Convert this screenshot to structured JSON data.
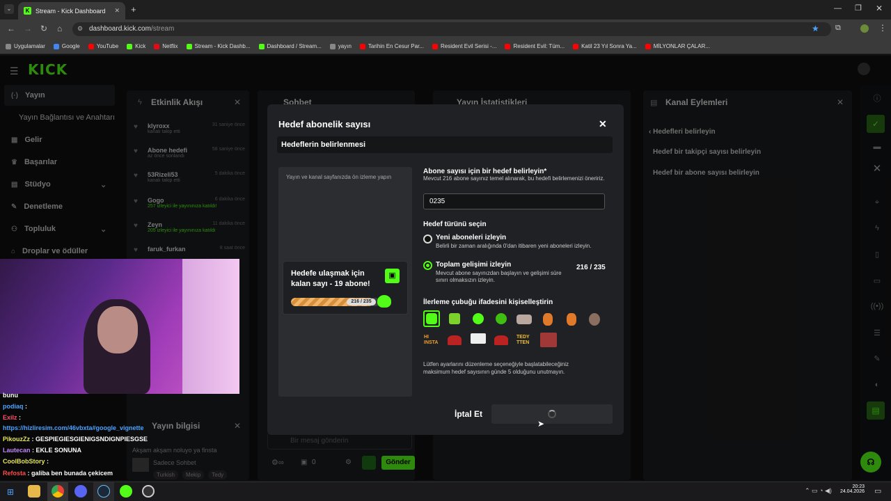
{
  "browser": {
    "tab_title": "Stream - Kick Dashboard",
    "url_host": "dashboard.kick.com",
    "url_path": "/stream",
    "bookmarks": [
      {
        "label": "Uygulamalar",
        "color": "#888"
      },
      {
        "label": "Google",
        "color": "#4285f4"
      },
      {
        "label": "YouTube",
        "color": "#ff0000"
      },
      {
        "label": "Kick",
        "color": "#53fc18"
      },
      {
        "label": "Netflix",
        "color": "#e50914"
      },
      {
        "label": "Stream - Kick Dashb...",
        "color": "#53fc18"
      },
      {
        "label": "Dashboard / Stream...",
        "color": "#53fc18"
      },
      {
        "label": "yayın",
        "color": "#888"
      },
      {
        "label": "Tarihin En Cesur Par...",
        "color": "#ff0000"
      },
      {
        "label": "Resident Evil Serisi -...",
        "color": "#ff0000"
      },
      {
        "label": "Resident Evil: Tüm...",
        "color": "#ff0000"
      },
      {
        "label": "Katil 23 Yıl Sonra Ya...",
        "color": "#ff0000"
      },
      {
        "label": "MİLYONLAR ÇALAR...",
        "color": "#ff0000"
      }
    ]
  },
  "kick": {
    "logo": "KICK",
    "sidebar": [
      "Yayın",
      "Yayın Bağlantısı ve Anahtarı",
      "Gelir",
      "Başarılar",
      "Stüdyo",
      "Denetleme",
      "Topluluk",
      "Droplar ve ödüller"
    ]
  },
  "panels": {
    "activity_title": "Etkinlik Akışı",
    "chat_title": "Sohbet",
    "stats_title": "Yayın İstatistikleri",
    "actions_title": "Kanal Eylemleri",
    "info_title": "Yayın bilgisi",
    "feed": [
      {
        "name": "klyroxx",
        "sub": "kanalı takip etti",
        "time": "31 saniye önce"
      },
      {
        "name": "Abone hedefi",
        "sub": "az önce sonlandı",
        "time": "58 saniye önce"
      },
      {
        "name": "53Rizeli53",
        "sub": "kanalı takip etti",
        "time": "5 dakika önce"
      },
      {
        "name": "Gogo",
        "sub": "257 izleyici ile yayınınıza katıldı!",
        "time": "6 dakika önce"
      },
      {
        "name": "Zeyn",
        "sub": "205 izleyici ile yayınınıza katıldı",
        "time": "11 dakika önce"
      },
      {
        "name": "faruk_furkan",
        "sub": "",
        "time": "8 saat önce"
      }
    ],
    "actions": {
      "back": "Hedefleri belirleyin",
      "item1": "Hedef bir takipçi sayısı belirleyin",
      "item2": "Hedef bir abone sayısı belirleyin"
    },
    "info_subtitle": "Akşam akşam noluyo ya finsta",
    "info_category": "Sadece Sohbet",
    "info_tags": [
      "Turkish",
      "Mekip",
      "Tedy"
    ],
    "chat_placeholder": "Bir mesaj gönderin",
    "chat_count": "0",
    "send_label": "Gönder"
  },
  "modal": {
    "title": "Hedef abonelik sayısı",
    "section": "Hedeflerin belirlenmesi",
    "preview_hint": "Yayın ve kanal sayfanızda ön izleme yapın",
    "widget_text": "Hedefe ulaşmak için kalan sayı - 19 abone!",
    "widget_progress_label": "216 / 235",
    "widget_progress": 0.919,
    "field_label": "Abone sayısı için bir hedef belirleyin*",
    "field_help": "Mevcut 216 abone sayınız temel alınarak, bu hedefi belirlemenizi öneririz.",
    "field_value": "0235",
    "type_label": "Hedef türünü seçin",
    "option1_title": "Yeni aboneleri izleyin",
    "option1_desc": "Belirli bir zaman aralığında 0'dan itibaren yeni aboneleri izleyin.",
    "option2_title": "Toplam gelişimi izleyin",
    "option2_desc": "Mevcut abone sayınızdan başlayın ve gelişimi süre sınırı olmaksızın izleyin.",
    "option2_value": "216 / 235",
    "emote_label": "İlerleme çubuğu ifadesini kişiselleştirin",
    "emote_texts": [
      "HI INSTA",
      "TEDY TTEN"
    ],
    "note": "Lütfen ayarlarını düzenleme seçeneğiyle başlatabileceğiniz maksimum hedef sayısının günde 5 olduğunu unutmayın.",
    "cancel": "İptal Et"
  },
  "chat_messages": [
    {
      "user": "",
      "text": "bunu",
      "color": "#ffffff"
    },
    {
      "user": "podiaq",
      "text": " : ",
      "color": "#4aa3ff"
    },
    {
      "user": "Exilz",
      "text": " :",
      "color": "#ff4a6b"
    },
    {
      "user": "",
      "text": "https://hizliresim.com/46vbxta#google_vignette",
      "color": "#4aa3ff"
    },
    {
      "user": "PikouzZz",
      "text": " : GESPIEGIESGIENIGSNDIGNPIESGSE",
      "color": "#e6e65a"
    },
    {
      "user": "Lautecan",
      "text": " : EKLE SONUNA",
      "color": "#c084fc"
    },
    {
      "user": "CoolBobStory",
      "text": " : ",
      "color": "#e6e65a"
    },
    {
      "user": "Refosta",
      "text": " : galiba ben bunada çekicem",
      "color": "#ff4a4a"
    }
  ],
  "taskbar": {
    "time": "20:23",
    "date": "24.04.2026"
  }
}
